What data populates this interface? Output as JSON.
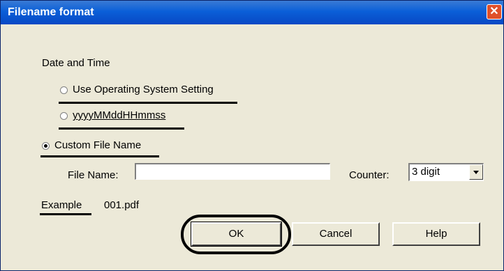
{
  "window": {
    "title": "Filename format",
    "close_glyph": "✕"
  },
  "date_time": {
    "heading": "Date and Time",
    "options": [
      {
        "label": "Use Operating System Setting",
        "selected": false
      },
      {
        "label": "yyyyMMddHHmmss",
        "selected": false
      }
    ]
  },
  "custom": {
    "label": "Custom File Name",
    "selected": true
  },
  "file_name": {
    "label": "File Name:",
    "value": ""
  },
  "counter": {
    "label": "Counter:",
    "value": "3 digit"
  },
  "example": {
    "label": "Example",
    "value": "001.pdf"
  },
  "buttons": {
    "ok": "OK",
    "cancel": "Cancel",
    "help": "Help"
  },
  "colors": {
    "titlebar": "#0a5fd8",
    "dialog_bg": "#ece9d8",
    "close_button": "#e0502a"
  },
  "icons": {
    "close": "close-icon",
    "dropdown": "chevron-down-icon"
  }
}
